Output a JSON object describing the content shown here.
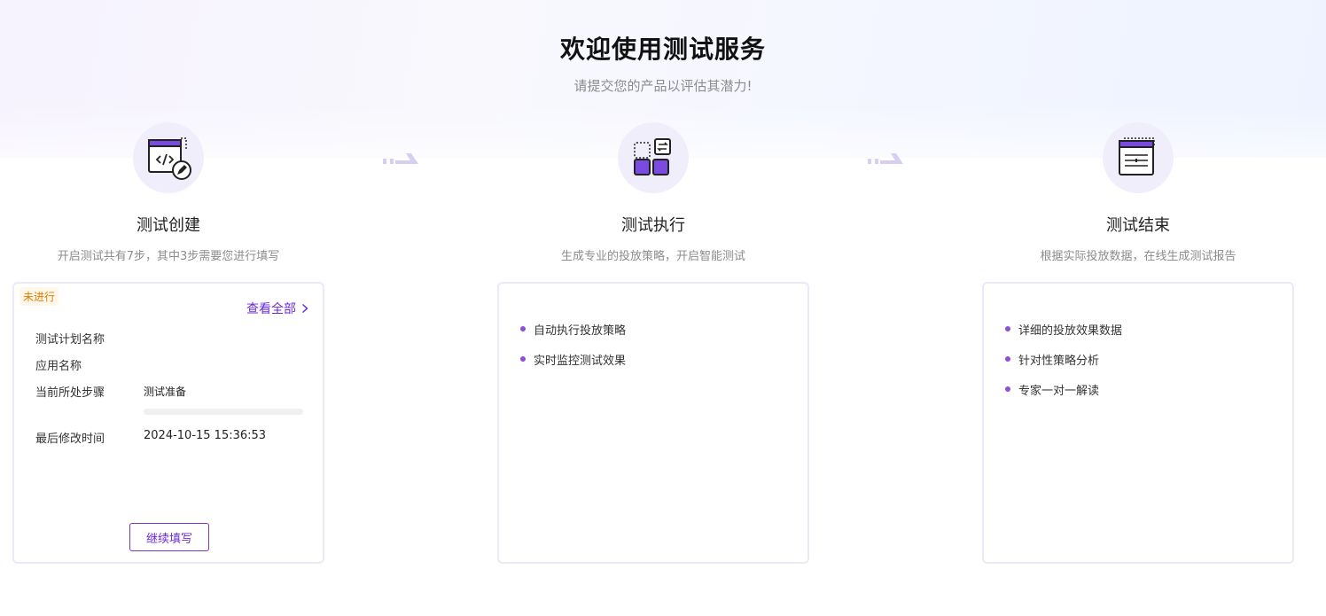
{
  "header": {
    "title": "欢迎使用测试服务",
    "subtitle": "请提交您的产品以评估其潜力!"
  },
  "steps": [
    {
      "icon": "code-edit-icon",
      "title": "测试创建",
      "desc": "开启测试共有7步，其中3步需要您进行填写"
    },
    {
      "icon": "blocks-exchange-icon",
      "title": "测试执行",
      "desc": "生成专业的投放策略，开启智能测试"
    },
    {
      "icon": "report-list-icon",
      "title": "测试结束",
      "desc": "根据实际投放数据，在线生成测试报告"
    }
  ],
  "create_card": {
    "status_badge": "未进行",
    "view_all": "查看全部",
    "fields": {
      "plan_name_label": "测试计划名称",
      "app_name_label": "应用名称",
      "current_step_label": "当前所处步骤",
      "current_step_value": "测试准备",
      "progress_percent": 0,
      "last_modified_label": "最后修改时间",
      "last_modified_value": "2024-10-15 15:36:53"
    },
    "continue_button": "继续填写"
  },
  "execute_card": {
    "bullets": [
      "自动执行投放策略",
      "实时监控测试效果"
    ]
  },
  "end_card": {
    "bullets": [
      "详细的投放效果数据",
      "针对性策略分析",
      "专家一对一解读"
    ]
  },
  "colors": {
    "accent": "#6c2bd9",
    "badge_text": "#e07b00",
    "icon_purple": "#7a4be0"
  }
}
